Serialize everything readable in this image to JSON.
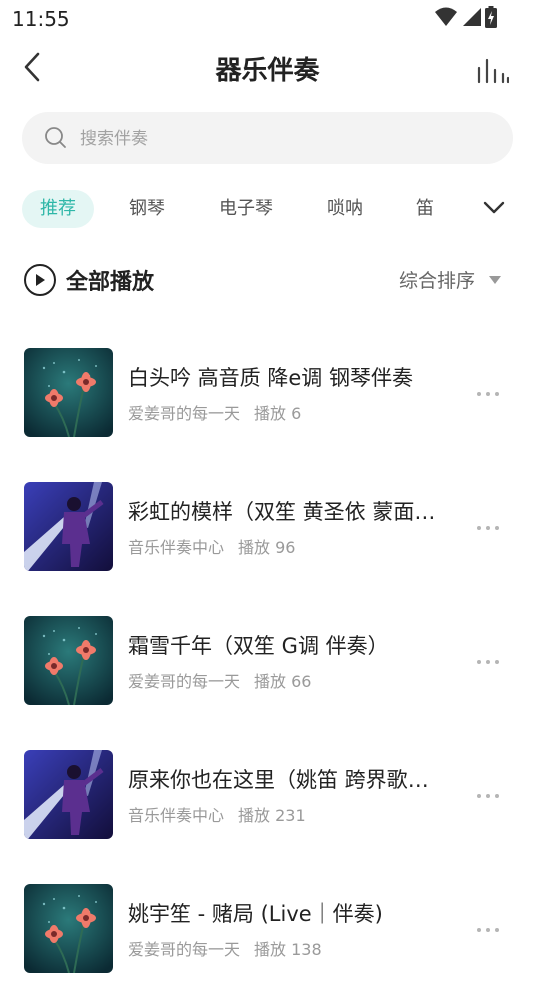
{
  "status_bar": {
    "time": "11:55"
  },
  "header": {
    "title": "器乐伴奏"
  },
  "search": {
    "placeholder": "搜索伴奏"
  },
  "tabs": [
    {
      "label": "推荐",
      "active": true
    },
    {
      "label": "钢琴",
      "active": false
    },
    {
      "label": "电子琴",
      "active": false
    },
    {
      "label": "唢呐",
      "active": false
    },
    {
      "label": "笛",
      "active": false
    }
  ],
  "play_all": {
    "label": "全部播放"
  },
  "sort": {
    "label": "综合排序"
  },
  "colors": {
    "accent": "#2fb7a8",
    "accent_bg": "#e4f6f4"
  },
  "songs": [
    {
      "title": "白头吟 高音质 降e调 钢琴伴奏",
      "author": "爱姜哥的每一天",
      "plays_label": "播放",
      "plays": "6",
      "cover": "flower"
    },
    {
      "title": "彩虹的模样（双笙 黄圣依 蒙面唱将 伴奏）",
      "author": "音乐伴奏中心",
      "plays_label": "播放",
      "plays": "96",
      "cover": "stage"
    },
    {
      "title": "霜雪千年（双笙 G调 伴奏）",
      "author": "爱姜哥的每一天",
      "plays_label": "播放",
      "plays": "66",
      "cover": "flower"
    },
    {
      "title": "原来你也在这里（姚笛 跨界歌王 伴奏）",
      "author": "音乐伴奏中心",
      "plays_label": "播放",
      "plays": "231",
      "cover": "stage"
    },
    {
      "title": "姚宇笙 - 赌局 (Live｜伴奏)",
      "author": "爱姜哥的每一天",
      "plays_label": "播放",
      "plays": "138",
      "cover": "flower"
    }
  ]
}
